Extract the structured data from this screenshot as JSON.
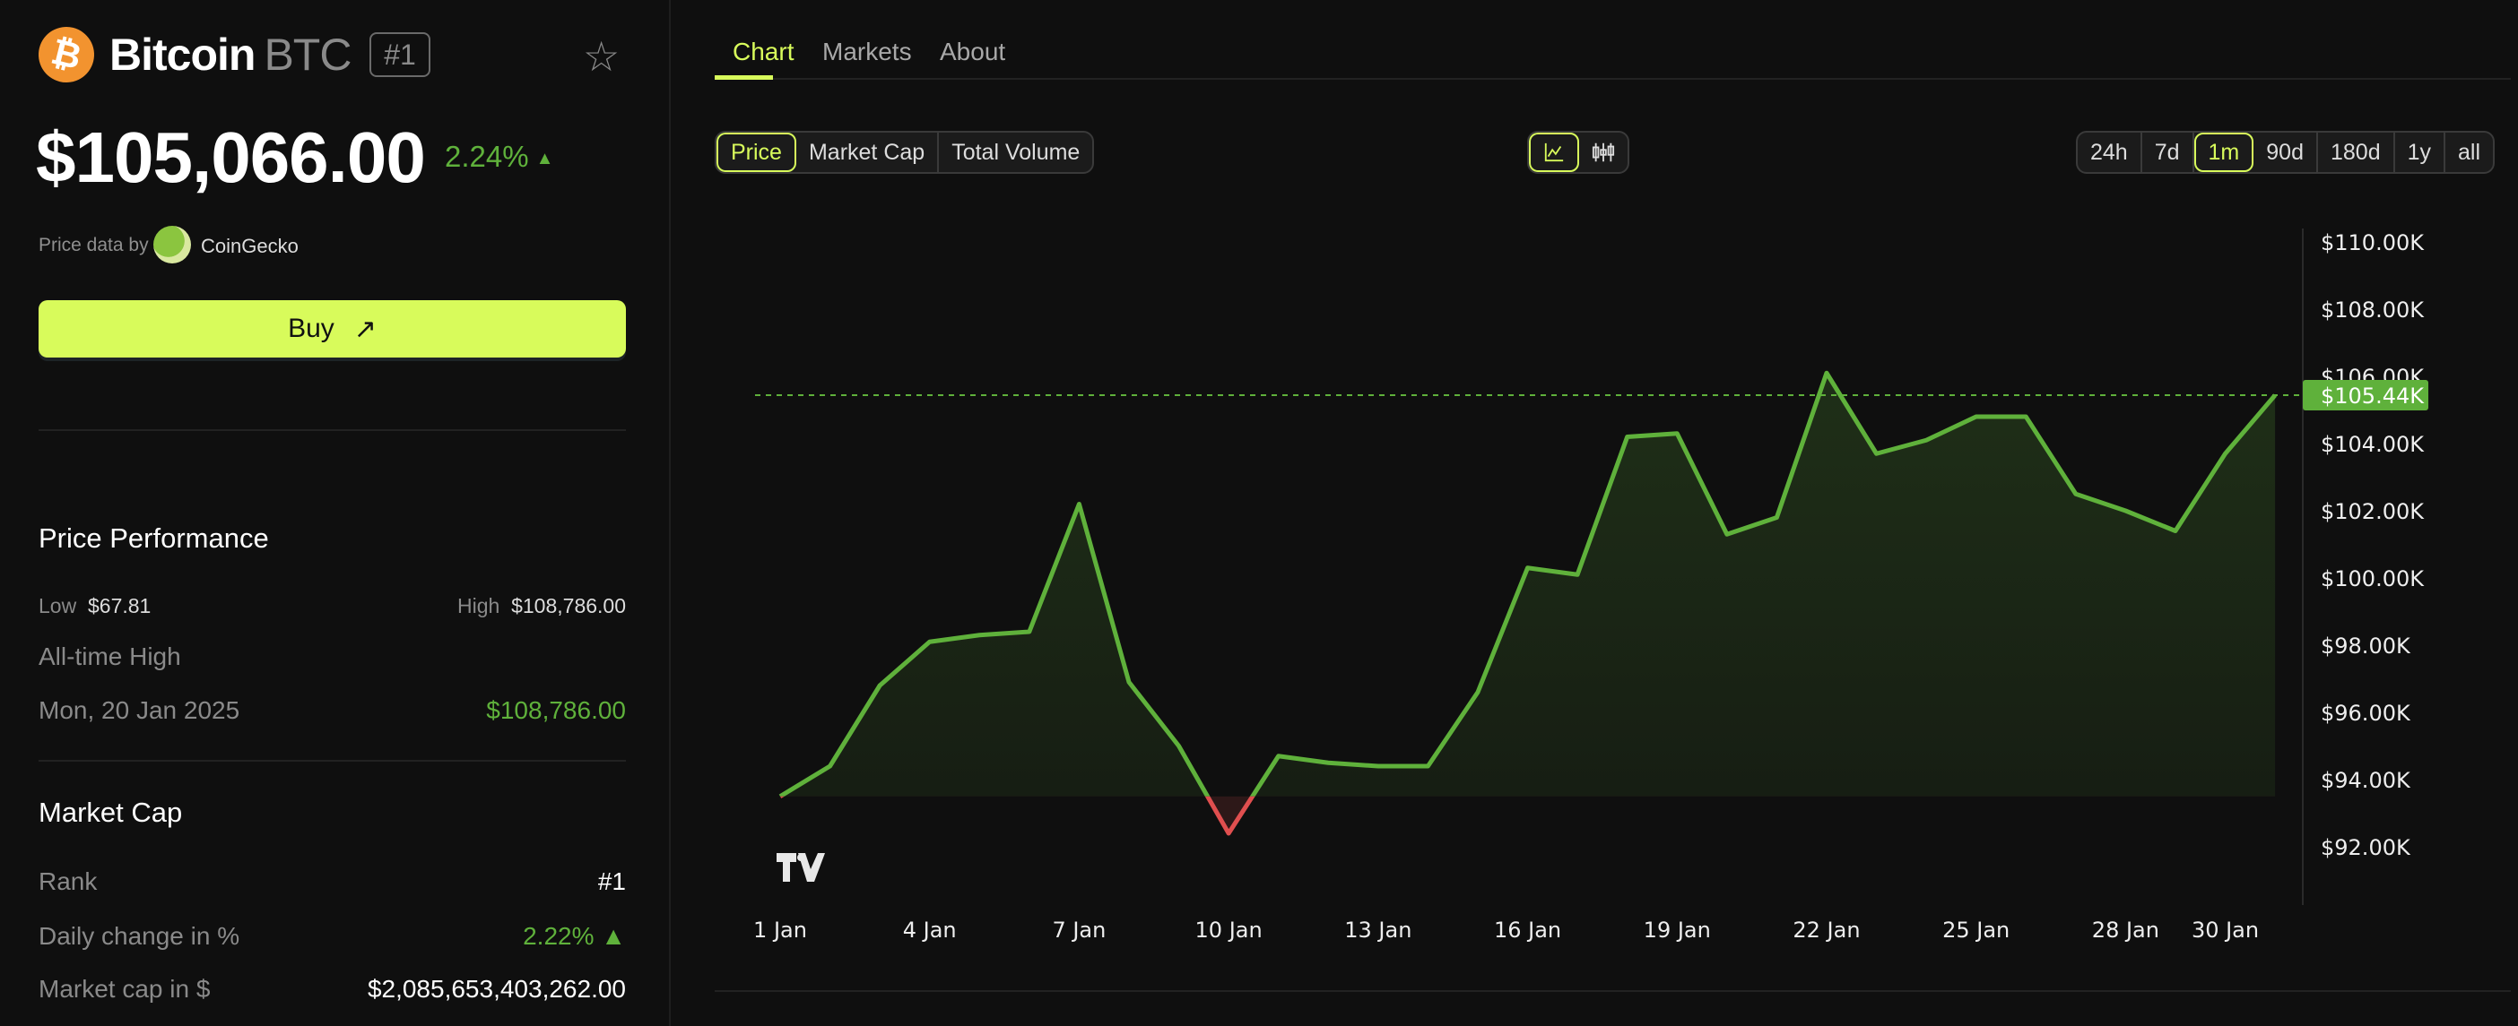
{
  "coin": {
    "icon": "bitcoin-icon",
    "name": "Bitcoin",
    "symbol": "BTC",
    "rank_badge": "#1",
    "price": "$105,066.00",
    "change": "2.24%",
    "change_dir": "▲",
    "price_data_by": "Price data by",
    "provider": "CoinGecko",
    "buy_label": "Buy",
    "buy_icon": "↗",
    "star_icon": "☆"
  },
  "performance": {
    "title": "Price Performance",
    "low_label": "Low",
    "low": "$67.81",
    "high_label": "High",
    "high": "$108,786.00",
    "ath_label": "All-time High",
    "ath_date": "Mon, 20 Jan 2025",
    "ath_value": "$108,786.00"
  },
  "market_cap": {
    "title": "Market Cap",
    "rows": [
      {
        "label": "Rank",
        "value": "#1"
      },
      {
        "label": "Daily change in %",
        "value": "2.22% ▲"
      },
      {
        "label": "Market cap in $",
        "value": "$2,085,653,403,262.00"
      }
    ]
  },
  "tabs": [
    {
      "label": "Chart",
      "active": true
    },
    {
      "label": "Markets"
    },
    {
      "label": "About"
    }
  ],
  "metric_tabs": [
    {
      "label": "Price",
      "active": true
    },
    {
      "label": "Market Cap"
    },
    {
      "label": "Total Volume"
    }
  ],
  "chart_types": [
    {
      "icon": "line-chart-icon",
      "active": true
    },
    {
      "icon": "candlestick-icon"
    }
  ],
  "ranges": [
    {
      "label": "24h"
    },
    {
      "label": "7d"
    },
    {
      "label": "1m",
      "active": true
    },
    {
      "label": "90d"
    },
    {
      "label": "180d"
    },
    {
      "label": "1y"
    },
    {
      "label": "all"
    }
  ],
  "colors": {
    "accent": "#d8fb5b",
    "up": "#5fb13b",
    "down": "#e04f4f",
    "bg": "#0f0f0f"
  },
  "chart_data": {
    "type": "area",
    "style": "baseline",
    "x_unit": "day of January",
    "x": [
      1,
      2,
      3,
      4,
      5,
      6,
      7,
      8,
      9,
      10,
      11,
      12,
      13,
      14,
      15,
      16,
      17,
      18,
      19,
      20,
      21,
      22,
      23,
      24,
      25,
      26,
      27,
      28,
      29,
      30,
      31
    ],
    "values_k": [
      93.5,
      94.4,
      96.8,
      98.1,
      98.3,
      98.4,
      102.2,
      96.9,
      95.0,
      92.4,
      94.7,
      94.5,
      94.4,
      94.4,
      96.6,
      100.3,
      100.1,
      104.2,
      104.3,
      101.3,
      101.8,
      106.1,
      103.7,
      104.1,
      104.8,
      104.8,
      102.5,
      102.0,
      101.4,
      103.7,
      105.44
    ],
    "ylim_k": [
      92,
      110
    ],
    "y_ticks": [
      "$92.00K",
      "$94.00K",
      "$96.00K",
      "$98.00K",
      "$100.00K",
      "$102.00K",
      "$104.00K",
      "$106.00K",
      "$108.00K",
      "$110.00K"
    ],
    "y_tick_values_k": [
      92,
      94,
      96,
      98,
      100,
      102,
      104,
      106,
      108,
      110
    ],
    "x_ticks": [
      "1 Jan",
      "4 Jan",
      "7 Jan",
      "10 Jan",
      "13 Jan",
      "16 Jan",
      "19 Jan",
      "22 Jan",
      "25 Jan",
      "28 Jan",
      "30 Jan"
    ],
    "x_tick_days": [
      1,
      4,
      7,
      10,
      13,
      16,
      19,
      22,
      25,
      28,
      30
    ],
    "last_price_label": "$105.44K",
    "watermark": "TV",
    "grid": false
  }
}
